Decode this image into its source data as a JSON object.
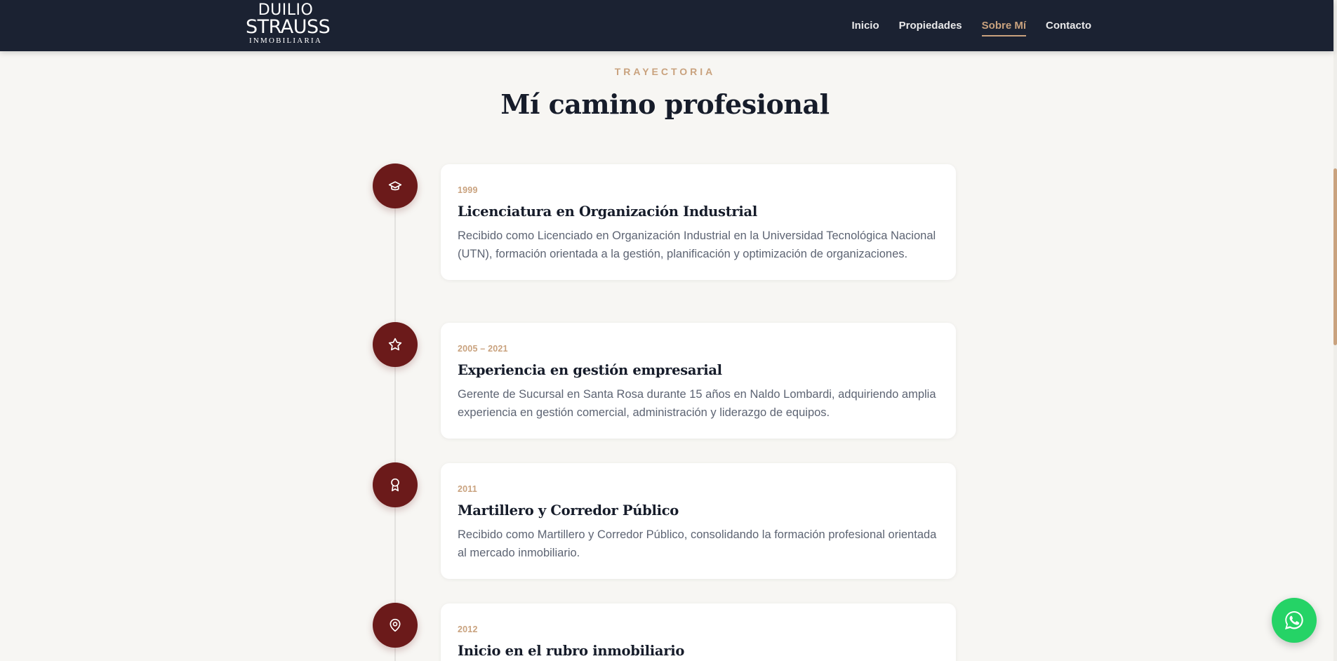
{
  "logo": {
    "line1": "DUILIO",
    "line2": "STRAUSS",
    "line3": "INMOBILIARIA"
  },
  "nav": {
    "items": [
      {
        "label": "Inicio",
        "active": false
      },
      {
        "label": "Propiedades",
        "active": false
      },
      {
        "label": "Sobre Mí",
        "active": true
      },
      {
        "label": "Contacto",
        "active": false
      }
    ]
  },
  "section": {
    "eyebrow": "TRAYECTORIA",
    "title": "Mí camino profesional"
  },
  "timeline": [
    {
      "icon": "graduation-cap-icon",
      "date": "1999",
      "title": "Licenciatura en Organización Industrial",
      "description": "Recibido como Licenciado en Organización Industrial en la Universidad Tecnológica Nacional (UTN), formación orientada a la gestión, planificación y optimización de organizaciones."
    },
    {
      "icon": "star-icon",
      "date": "2005 – 2021",
      "title": "Experiencia en gestión empresarial",
      "description": "Gerente de Sucursal en Santa Rosa durante 15 años en Naldo Lombardi, adquiriendo amplia experiencia en gestión comercial, administración y liderazgo de equipos."
    },
    {
      "icon": "award-icon",
      "date": "2011",
      "title": "Martillero y Corredor Público",
      "description": "Recibido como Martillero y Corredor Público, consolidando la formación profesional orientada al mercado inmobiliario."
    },
    {
      "icon": "map-pin-icon",
      "date": "2012",
      "title": "Inicio en el rubro inmobiliario",
      "description": ""
    }
  ],
  "colors": {
    "navbar": "#1b2232",
    "accent": "#c9a27e",
    "icon_bg": "#6b1a1a",
    "whatsapp": "#25d366"
  },
  "whatsapp": {
    "icon": "whatsapp-icon"
  }
}
